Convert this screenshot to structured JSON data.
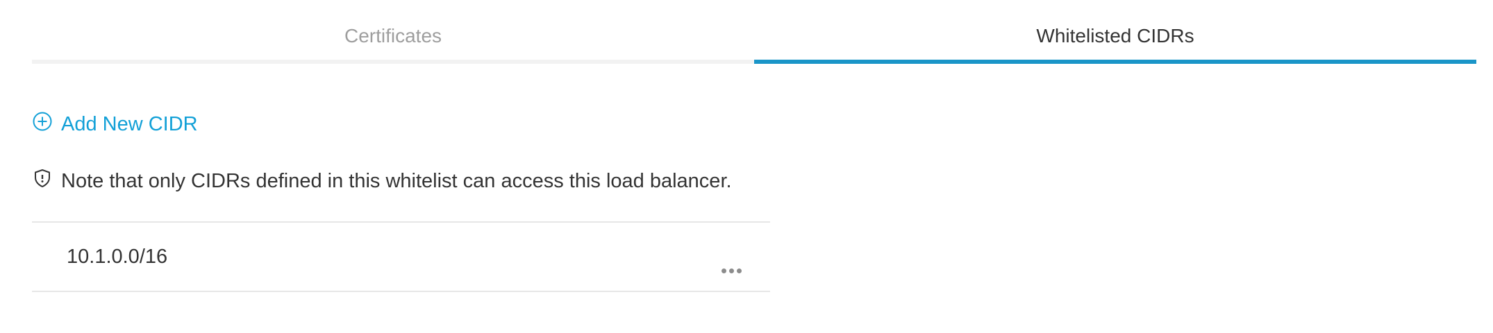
{
  "tabs": [
    {
      "label": "Certificates",
      "active": false
    },
    {
      "label": "Whitelisted CIDRs",
      "active": true
    }
  ],
  "add_cidr": {
    "label": "Add New CIDR",
    "icon": "plus-circle-icon"
  },
  "note": {
    "text": "Note that only CIDRs defined in this whitelist can access this load balancer.",
    "icon": "shield-icon"
  },
  "cidrs": [
    {
      "value": "10.1.0.0/16",
      "actions_icon": "more-horizontal-icon"
    }
  ],
  "colors": {
    "accent": "#1a95c8",
    "link": "#12a0d7",
    "inactive_text": "#9e9e9e",
    "text": "#333333",
    "divider": "#e6e6e6"
  }
}
